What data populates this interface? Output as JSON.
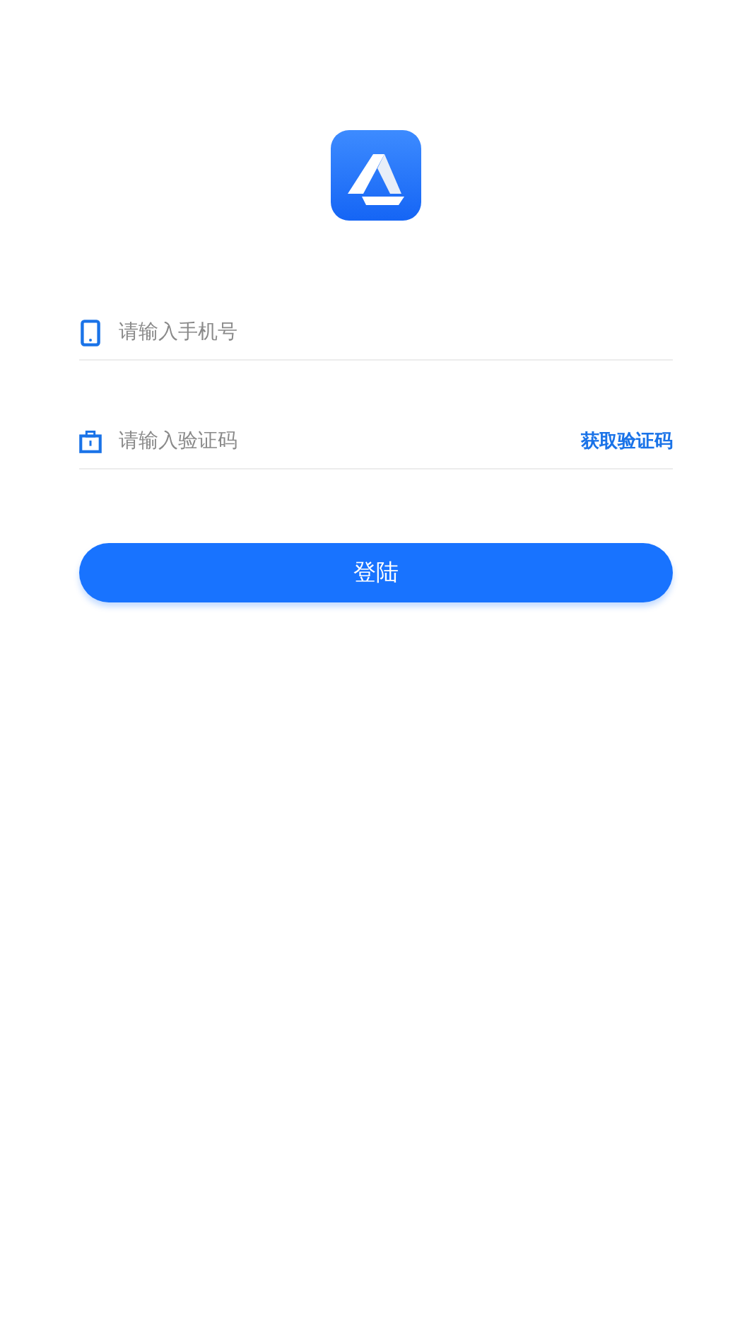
{
  "fields": [
    {
      "kind": "phone",
      "placeholder": "请输入手机号"
    },
    {
      "kind": "code",
      "placeholder": "请输入验证码",
      "action": "获取验证码"
    }
  ],
  "login_button": "登陆"
}
